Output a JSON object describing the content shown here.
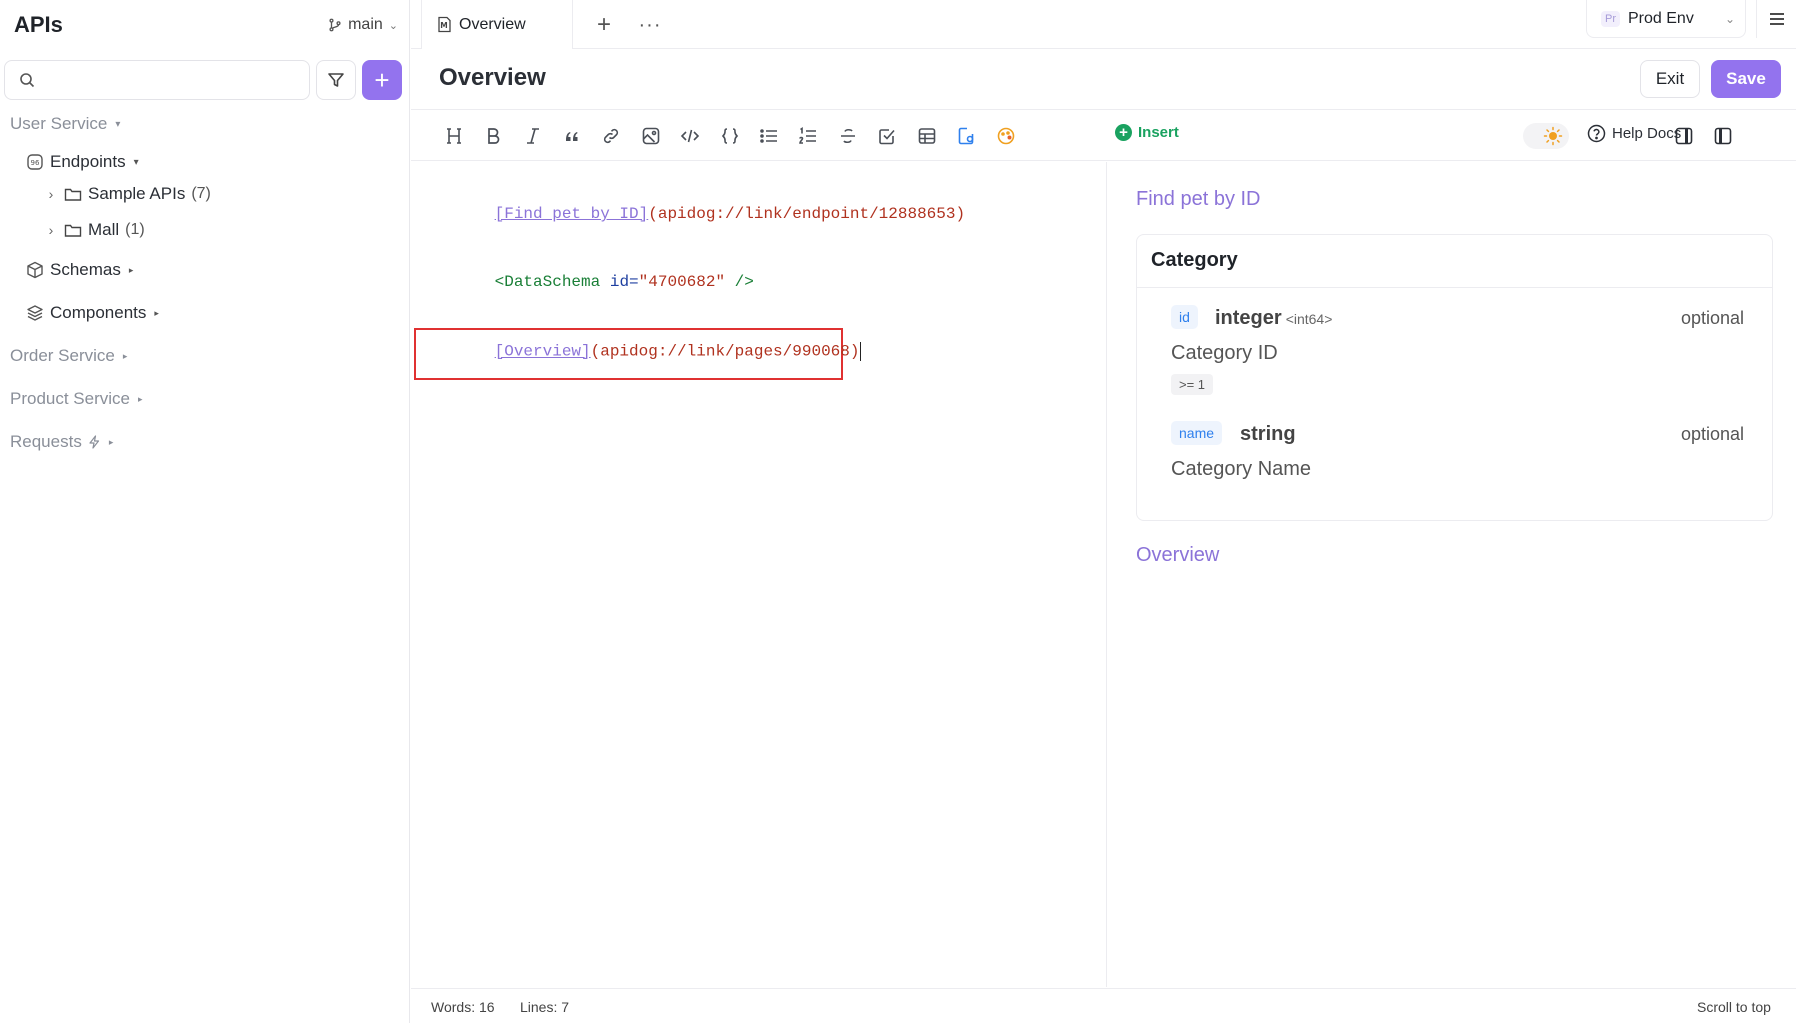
{
  "sidebar": {
    "title": "APIs",
    "branch": "main",
    "search": {
      "placeholder": "",
      "value": ""
    },
    "services": {
      "user": "User Service",
      "order": "Order Service",
      "product": "Product Service",
      "requests": "Requests"
    },
    "endpoints": "Endpoints",
    "folders": [
      {
        "label": "Sample APIs",
        "count": "(7)"
      },
      {
        "label": "Mall",
        "count": "(1)"
      }
    ],
    "schemas": "Schemas",
    "components": "Components"
  },
  "tabs": {
    "active": "Overview"
  },
  "env": {
    "badge": "Pr",
    "label": "Prod Env"
  },
  "page": {
    "title": "Overview",
    "exit": "Exit",
    "save": "Save"
  },
  "toolbar": {
    "insert": "Insert",
    "help": "Help Docs",
    "icons": [
      "heading-icon",
      "bold-icon",
      "italic-icon",
      "quote-icon",
      "link-icon",
      "image-icon",
      "code-icon",
      "code-block-icon",
      "bullet-list-icon",
      "ordered-list-icon",
      "strikethrough-icon",
      "task-list-icon",
      "table-icon",
      "endpoint-link-icon",
      "schema-icon"
    ]
  },
  "editor": {
    "line1": {
      "link": "[Find pet by ID]",
      "url": "(apidog://link/endpoint/12888653)"
    },
    "line2": {
      "open": "<DataSchema",
      "attr": "id",
      "eq": "=",
      "val": "\"4700682\"",
      "close": " />"
    },
    "line3": {
      "link": "[Overview]",
      "url": "(apidog://link/pages/990068)"
    }
  },
  "preview": {
    "endpoint_link": "Find pet by ID",
    "schema": {
      "title": "Category",
      "props": [
        {
          "key": "id",
          "type": "integer",
          "format": "<int64>",
          "optional": "optional",
          "desc": "Category ID",
          "constraint": ">= 1"
        },
        {
          "key": "name",
          "type": "string",
          "format": "",
          "optional": "optional",
          "desc": "Category Name",
          "constraint": ""
        }
      ]
    },
    "page_link": "Overview"
  },
  "status": {
    "words": "Words: 16",
    "lines": "Lines: 7",
    "scroll": "Scroll to top"
  },
  "colors": {
    "accent": "#9373ee",
    "insert": "#1aa260",
    "highlight": "#e03131",
    "link": "#8b73d8"
  }
}
